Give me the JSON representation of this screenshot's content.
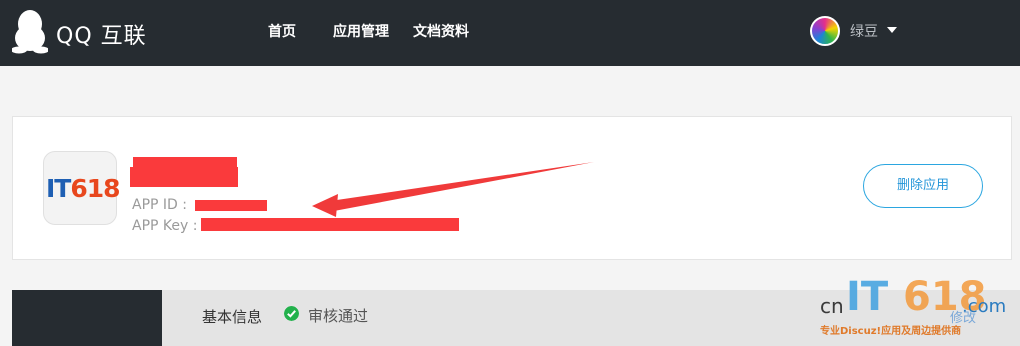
{
  "header": {
    "brand": "QQ 互联",
    "nav": [
      "首页",
      "应用管理",
      "文档资料"
    ],
    "user": {
      "name": "绿豆"
    }
  },
  "app": {
    "app_id_label": "APP ID :",
    "app_key_label": "APP Key :",
    "icon_text_it": "IT",
    "icon_text_num": "618",
    "delete_label": "删除应用"
  },
  "tabs": {
    "basic_info": "基本信息",
    "status": "审核通过"
  },
  "watermark": {
    "cn": "cn",
    "it": "IT",
    "num": "618",
    "com": ".com",
    "edit": "修改",
    "tagline": "专业Discuz!应用及周边提供商"
  },
  "colors": {
    "topbar": "#262c31",
    "accent": "#2ba6e0",
    "redaction": "#fa3a3c",
    "status_ok": "#22b14c"
  },
  "icons": [
    "qq-penguin-icon",
    "user-avatar",
    "chevron-down-icon",
    "check-circle-icon",
    "annotation-arrow"
  ]
}
